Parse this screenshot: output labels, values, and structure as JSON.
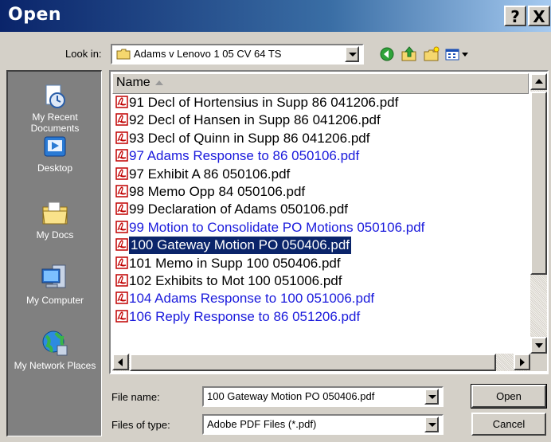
{
  "window": {
    "title": "Open",
    "help_label": "?",
    "close_label": "X"
  },
  "lookin": {
    "label": "Look in:",
    "value": "Adams v Lenovo 1 05 CV 64 TS"
  },
  "toolbar": {
    "icons": [
      "back-icon",
      "up-folder-icon",
      "new-folder-icon",
      "view-menu-icon"
    ]
  },
  "places": [
    {
      "label": "My Recent Documents",
      "icon": "recent-documents-icon"
    },
    {
      "label": "Desktop",
      "icon": "desktop-icon"
    },
    {
      "label": "My Docs",
      "icon": "my-documents-icon"
    },
    {
      "label": "My Computer",
      "icon": "my-computer-icon"
    },
    {
      "label": "My Network Places",
      "icon": "network-places-icon"
    }
  ],
  "filelist": {
    "column_header": "Name",
    "rows": [
      {
        "name": "91 Decl of Hortensius in Supp 86 041206.pdf",
        "blue": false,
        "selected": false
      },
      {
        "name": "92 Decl of Hansen in Supp 86 041206.pdf",
        "blue": false,
        "selected": false
      },
      {
        "name": "93 Decl of Quinn in Supp 86 041206.pdf",
        "blue": false,
        "selected": false
      },
      {
        "name": "97 Adams Response to 86 050106.pdf",
        "blue": true,
        "selected": false
      },
      {
        "name": "97 Exhibit A 86 050106.pdf",
        "blue": false,
        "selected": false
      },
      {
        "name": "98 Memo Opp 84 050106.pdf",
        "blue": false,
        "selected": false
      },
      {
        "name": "99 Declaration of Adams 050106.pdf",
        "blue": false,
        "selected": false
      },
      {
        "name": "99 Motion to Consolidate PO Motions 050106.pdf",
        "blue": true,
        "selected": false
      },
      {
        "name": "100 Gateway Motion PO 050406.pdf",
        "blue": false,
        "selected": true
      },
      {
        "name": "101 Memo in Supp 100 050406.pdf",
        "blue": false,
        "selected": false
      },
      {
        "name": "102 Exhibits to Mot 100 051006.pdf",
        "blue": false,
        "selected": false
      },
      {
        "name": "104 Adams Response to 100 051006.pdf",
        "blue": true,
        "selected": false
      },
      {
        "name": "106 Reply Response to 86 051206.pdf",
        "blue": true,
        "selected": false
      }
    ]
  },
  "filename": {
    "label": "File name:",
    "value": "100 Gateway Motion PO 050406.pdf"
  },
  "filetype": {
    "label": "Files of type:",
    "value": "Adobe PDF Files (*.pdf)"
  },
  "buttons": {
    "open": "Open",
    "cancel": "Cancel"
  },
  "colors": {
    "selection": "#0a246a",
    "encrypted_blue": "#1a1adc",
    "face": "#d4d0c8"
  }
}
